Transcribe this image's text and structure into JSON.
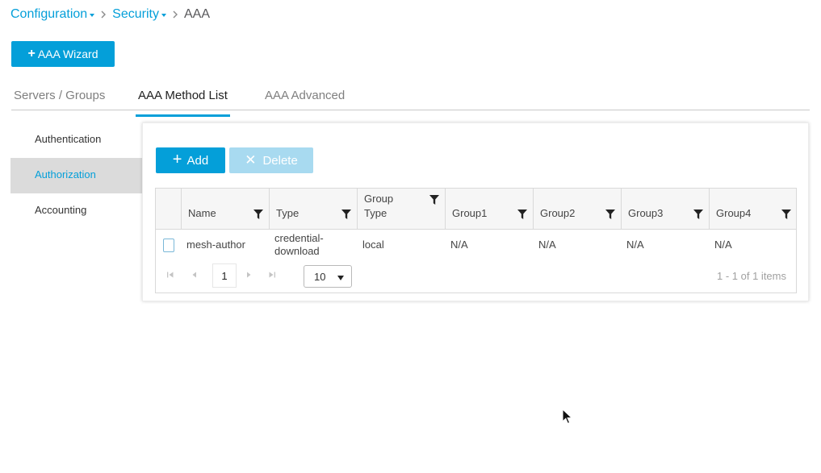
{
  "breadcrumb": {
    "items": [
      {
        "label": "Configuration",
        "dropdown": true
      },
      {
        "label": "Security",
        "dropdown": true
      }
    ],
    "current": "AAA"
  },
  "wizard_button": {
    "label": "AAA Wizard",
    "icon": "plus-icon"
  },
  "tabs": [
    {
      "label": "Servers / Groups",
      "active": false
    },
    {
      "label": "AAA Method List",
      "active": true
    },
    {
      "label": "AAA Advanced",
      "active": false
    }
  ],
  "sidenav": {
    "items": [
      {
        "label": "Authentication",
        "active": false
      },
      {
        "label": "Authorization",
        "active": true
      },
      {
        "label": "Accounting",
        "active": false
      }
    ]
  },
  "toolbar": {
    "add_label": "Add",
    "delete_label": "Delete"
  },
  "grid": {
    "columns": [
      {
        "label": "Name"
      },
      {
        "label": "Type"
      },
      {
        "label": "Group Type"
      },
      {
        "label": "Group1"
      },
      {
        "label": "Group2"
      },
      {
        "label": "Group3"
      },
      {
        "label": "Group4"
      }
    ],
    "rows": [
      {
        "name": "mesh-author",
        "type": "credential-download",
        "group_type": "local",
        "group1": "N/A",
        "group2": "N/A",
        "group3": "N/A",
        "group4": "N/A"
      }
    ]
  },
  "pager": {
    "current_page": "1",
    "page_size": "10",
    "info": "1 - 1 of 1 items"
  },
  "colors": {
    "accent": "#049fd9",
    "accent_disabled": "#a8daf0",
    "nav_active_bg": "#dbdbdb"
  }
}
